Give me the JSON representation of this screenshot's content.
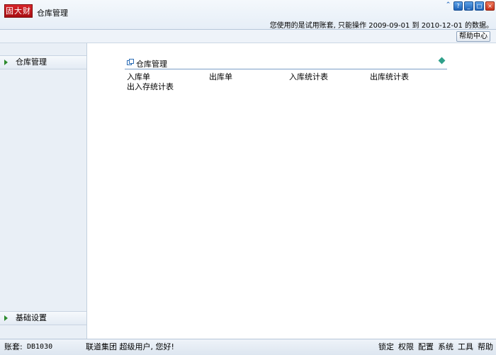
{
  "header": {
    "logo_text": "固大财",
    "app_title": "仓库管理",
    "trial_notice": "您使用的是试用账套, 只能操作 2009-09-01 到 2010-12-01 的数据。",
    "window_buttons": [
      "chevron-up-icon",
      "help-icon",
      "minimize-icon",
      "restore-icon",
      "close-icon"
    ]
  },
  "subbar": {
    "help_label": "帮助中心"
  },
  "sidebar": {
    "items": [
      {
        "label": "仓库管理"
      },
      {
        "label": "基础设置"
      }
    ]
  },
  "main": {
    "panel_title": "仓库管理",
    "links": [
      "入库单",
      "出库单",
      "入库统计表",
      "出库统计表",
      "出入存统计表"
    ]
  },
  "status": {
    "account_label": "账套:",
    "account_value": "DB1030",
    "greeting": "联道集团 超级用户, 您好!",
    "tools": [
      "锁定",
      "权限",
      "配置",
      "系统",
      "工具",
      "帮助"
    ]
  },
  "colors": {
    "accent": "#1f63b8",
    "logo_bg": "#c8161d",
    "sidebar_arrow": "#2d8a2d",
    "panel_rule": "#7b9ec7"
  }
}
